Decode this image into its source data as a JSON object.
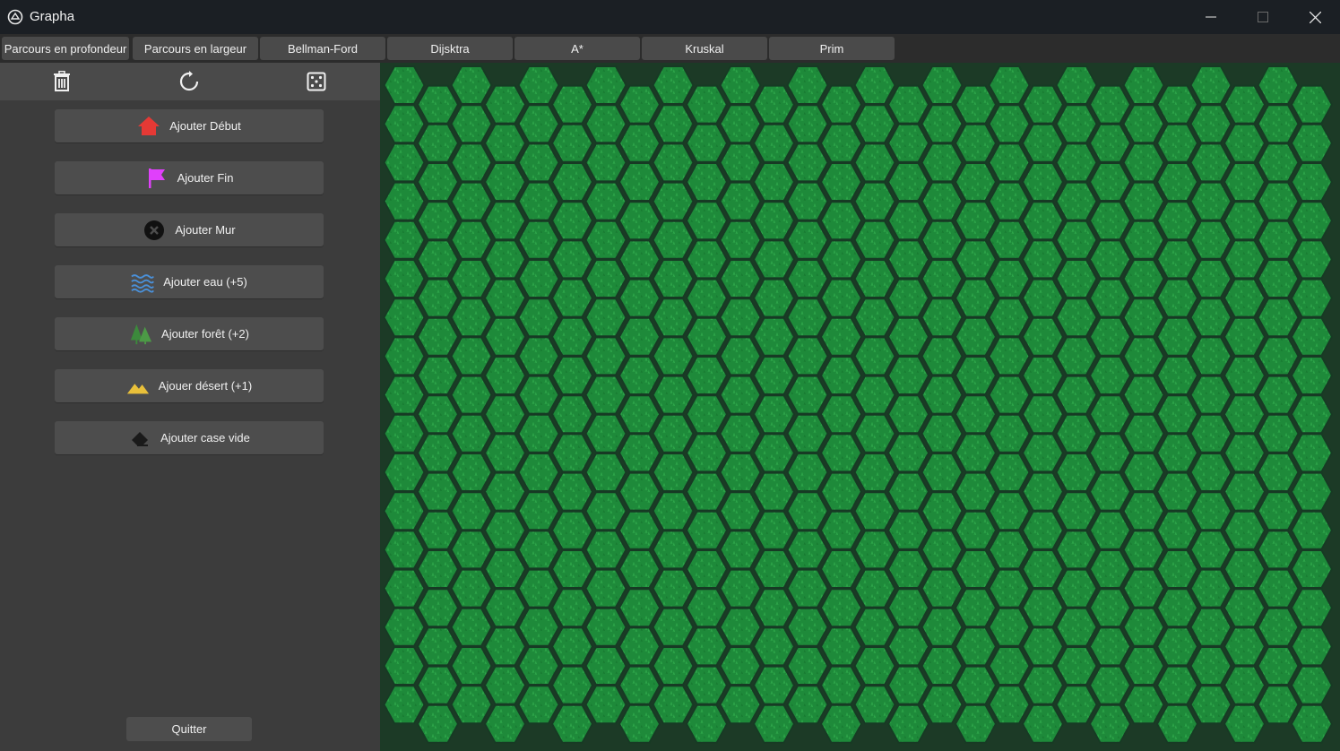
{
  "window": {
    "title": "Grapha",
    "controls": {
      "minimize": "minimize",
      "maximize": "maximize",
      "close": "close"
    }
  },
  "tabs": [
    {
      "label": "Parcours en profondeur"
    },
    {
      "label": "Parcours en largeur"
    },
    {
      "label": "Bellman-Ford"
    },
    {
      "label": "Dijsktra"
    },
    {
      "label": "A*"
    },
    {
      "label": "Kruskal"
    },
    {
      "label": "Prim"
    }
  ],
  "toolbar": {
    "icons": [
      "trash-icon",
      "reset-icon",
      "dice-icon"
    ]
  },
  "sidebar": {
    "buttons": [
      {
        "label": "Ajouter Début",
        "icon": "house-icon",
        "color": "#e53935"
      },
      {
        "label": "Ajouter Fin",
        "icon": "flag-icon",
        "color": "#e040fb"
      },
      {
        "label": "Ajouter Mur",
        "icon": "wall-icon",
        "color": "#111111"
      },
      {
        "label": "Ajouter eau (+5)",
        "icon": "water-icon",
        "color": "#4a90d9"
      },
      {
        "label": "Ajouter forêt (+2)",
        "icon": "forest-icon",
        "color": "#3c8a3c"
      },
      {
        "label": "Ajouer désert (+1)",
        "icon": "desert-icon",
        "color": "#e9c03a"
      },
      {
        "label": "Ajouter case vide",
        "icon": "eraser-icon",
        "color": "#1a1a1a"
      }
    ],
    "quit_label": "Quitter"
  },
  "grid": {
    "cell_type": "grass",
    "columns": 28,
    "rows": 17,
    "fill_color": "#1e8a3a",
    "border_color": "#173a24"
  }
}
